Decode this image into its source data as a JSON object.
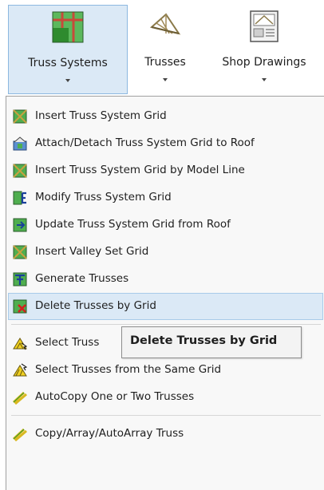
{
  "ribbon": {
    "truss_systems": "Truss Systems",
    "trusses": "Trusses",
    "shop_drawings": "Shop Drawings"
  },
  "menu": {
    "items": [
      "Insert Truss System Grid",
      "Attach/Detach Truss System Grid to Roof",
      "Insert Truss System Grid by Model Line",
      "Modify Truss System Grid",
      "Update Truss System Grid from Roof",
      "Insert Valley Set Grid",
      "Generate Trusses",
      "Delete Trusses by Grid",
      "Select Truss",
      "Select Trusses from the Same Grid",
      "AutoCopy One or Two Trusses",
      "Copy/Array/AutoArray Truss"
    ],
    "highlighted": "Delete Trusses by Grid"
  },
  "tooltip": "Delete Trusses by Grid",
  "colors": {
    "highlight_bg": "#dbe9f6",
    "highlight_border": "#8cb8e0",
    "menu_bg": "#f8f8f8"
  }
}
